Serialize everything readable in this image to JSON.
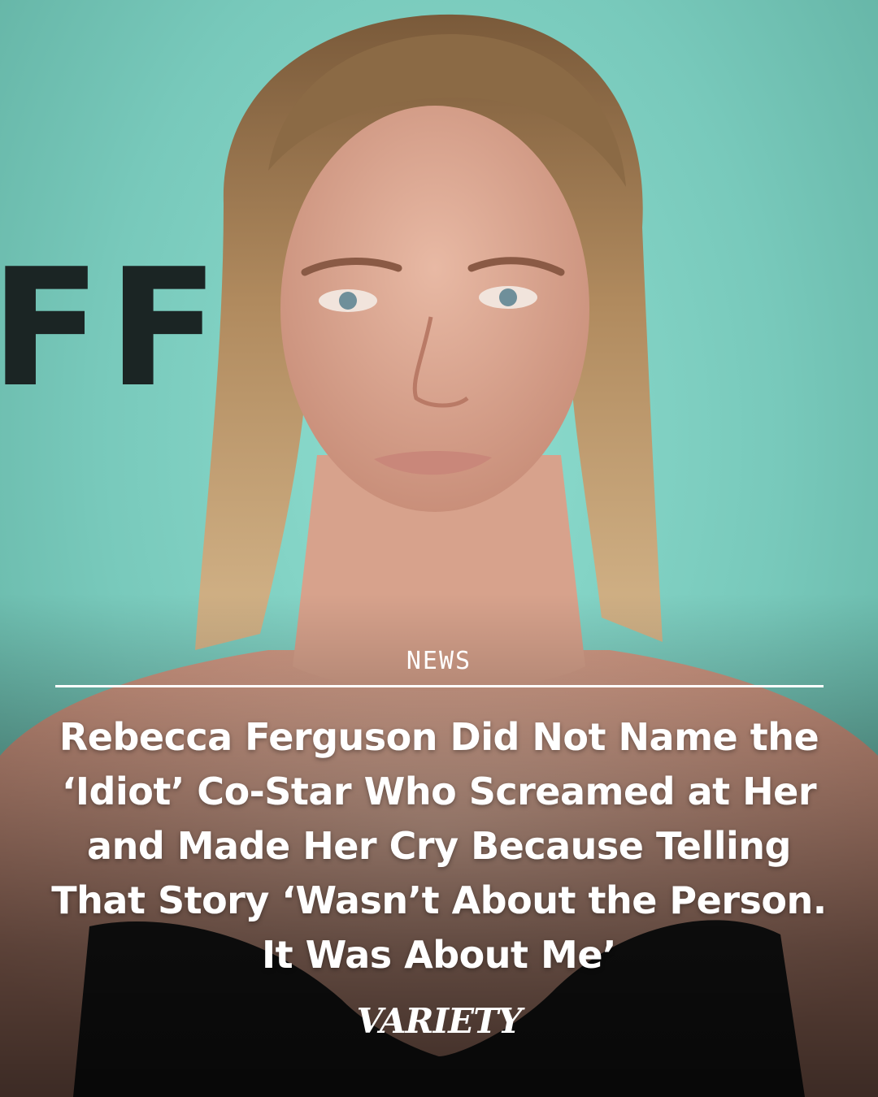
{
  "image": {
    "backdrop_color": "#7fcfc0",
    "backdrop_letters": "FF"
  },
  "post": {
    "category": "NEWS",
    "headline": "Rebecca Ferguson Did Not Name the ‘Idiot’ Co-Star Who Screamed at Her and Made Her Cry Because Telling That Story ‘Wasn’t About the Person. It Was About Me’",
    "brand": "VARIETY"
  }
}
